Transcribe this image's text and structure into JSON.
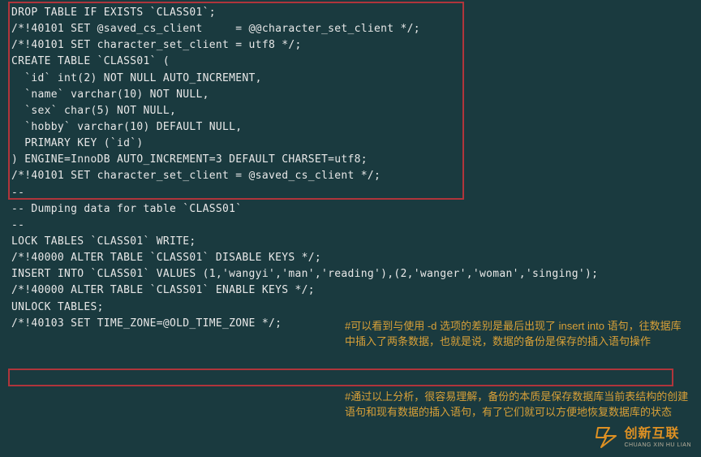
{
  "sql": {
    "l1": "DROP TABLE IF EXISTS `CLASS01`;",
    "l2": "/*!40101 SET @saved_cs_client     = @@character_set_client */;",
    "l3": "/*!40101 SET character_set_client = utf8 */;",
    "l4": "CREATE TABLE `CLASS01` (",
    "l5": "  `id` int(2) NOT NULL AUTO_INCREMENT,",
    "l6": "  `name` varchar(10) NOT NULL,",
    "l7": "  `sex` char(5) NOT NULL,",
    "l8": "  `hobby` varchar(10) DEFAULT NULL,",
    "l9": "  PRIMARY KEY (`id`)",
    "l10": ") ENGINE=InnoDB AUTO_INCREMENT=3 DEFAULT CHARSET=utf8;",
    "l11": "/*!40101 SET character_set_client = @saved_cs_client */;",
    "l12": "",
    "l13": "--",
    "l14": "-- Dumping data for table `CLASS01`",
    "l15": "--",
    "l16": "",
    "l17": "LOCK TABLES `CLASS01` WRITE;",
    "l18": "/*!40000 ALTER TABLE `CLASS01` DISABLE KEYS */;",
    "l19": "INSERT INTO `CLASS01` VALUES (1,'wangyi','man','reading'),(2,'wanger','woman','singing');",
    "l20": "/*!40000 ALTER TABLE `CLASS01` ENABLE KEYS */;",
    "l21": "UNLOCK TABLES;",
    "l22": "/*!40103 SET TIME_ZONE=@OLD_TIME_ZONE */;"
  },
  "note1": "#可以看到与使用 -d 选项的差别是最后出现了 insert into 语句，往数据库中插入了两条数据，也就是说，数据的备份是保存的插入语句操作",
  "note2": "#通过以上分析，很容易理解，备份的本质是保存数据库当前表结构的创建语句和现有数据的插入语句，有了它们就可以方便地恢复数据库的状态",
  "logo": {
    "cn": "创新互联",
    "en": "CHUANG XIN HU LIAN"
  }
}
